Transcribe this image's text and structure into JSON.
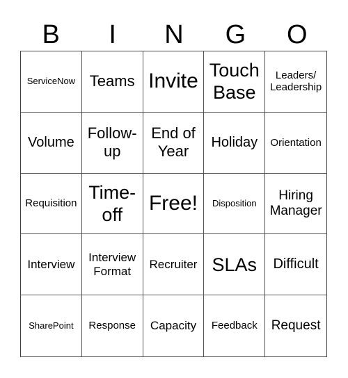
{
  "header": {
    "letters": [
      "B",
      "I",
      "N",
      "G",
      "O"
    ]
  },
  "board": {
    "rows": [
      [
        "ServiceNow",
        "Teams",
        "Invite",
        "Touch Base",
        "Leaders/ Leadership"
      ],
      [
        "Volume",
        "Follow-up",
        "End of Year",
        "Holiday",
        "Orientation"
      ],
      [
        "Requisition",
        "Time-off",
        "Free!",
        "Disposition",
        "Hiring Manager"
      ],
      [
        "Interview",
        "Interview Format",
        "Recruiter",
        "SLAs",
        "Difficult"
      ],
      [
        "SharePoint",
        "Response",
        "Capacity",
        "Feedback",
        "Request"
      ]
    ]
  }
}
